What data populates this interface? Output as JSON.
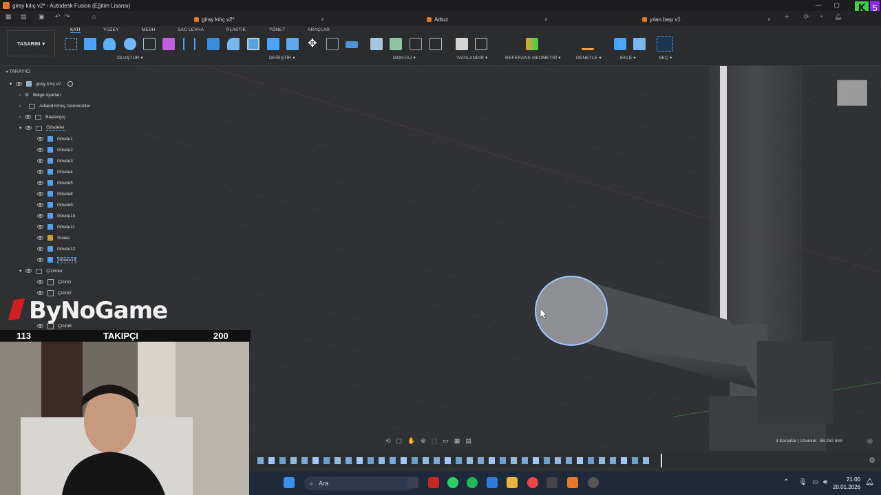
{
  "window": {
    "title": "giray kılıç v2* - Autodesk Fusion (Eğitim Lisansı)"
  },
  "tabs": [
    {
      "label": "giray kılıç v2*"
    },
    {
      "label": "Adsız"
    },
    {
      "label": "yılan başı v1"
    }
  ],
  "ribbon": {
    "workspace": "TASARIM",
    "tabs": [
      "KATI",
      "YÜZEY",
      "MESH",
      "SAC LEVHA",
      "PLASTİK",
      "YÖNET",
      "ARAÇLAR"
    ],
    "groups": [
      "OLUŞTUR",
      "DEĞİŞTİR",
      "MONTAJ",
      "YAPILANDIR",
      "REFERANS GEOMETRİ",
      "DENETLE",
      "EKLE",
      "SEÇ"
    ]
  },
  "browser": {
    "header": "TARAYICI",
    "root": "giray kılıç v2",
    "items": [
      "Belge Ayarları",
      "Adlandırılmış Görünümler",
      "Başlangıç",
      "Gövdeler"
    ],
    "bodies": [
      "Gövde1",
      "Gövde2",
      "Gövde3",
      "Gövde4",
      "Gövde5",
      "Gövde8",
      "Gövde9",
      "Gövde10",
      "Gövde11",
      "Snake",
      "Gövde12",
      "Gövde13"
    ],
    "sketches_folder": "Çizimler",
    "sketches": [
      "Çizim1",
      "Çizim2",
      "Çizim6"
    ]
  },
  "overlay": {
    "logo": "ByNoGame",
    "follow_count": "113",
    "follow_label": "TAKIPÇI",
    "follow_goal": "200"
  },
  "status": {
    "selection": "3 Kenarlar | Uzunluk : 68.252 mm"
  },
  "taskbar": {
    "search": "Ara",
    "time": "21:00",
    "date": "20.01.2026"
  },
  "colors": {
    "accent": "#4aa3ff",
    "fusion_orange": "#e8762b",
    "selection": "#9ec8ff"
  }
}
